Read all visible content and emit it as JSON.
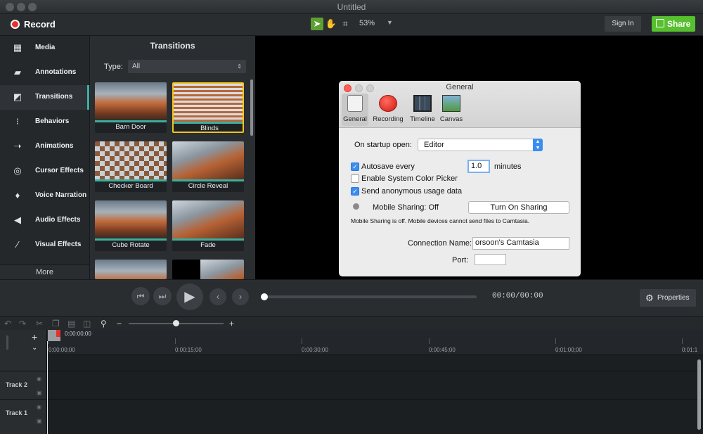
{
  "window": {
    "title": "Untitled"
  },
  "toolbar": {
    "record_label": "Record",
    "zoom": "53%",
    "signin_label": "Sign In",
    "share_label": "Share"
  },
  "sidebar": {
    "items": [
      {
        "label": "Media",
        "icon": "film-icon"
      },
      {
        "label": "Annotations",
        "icon": "annotation-icon"
      },
      {
        "label": "Transitions",
        "icon": "transition-icon"
      },
      {
        "label": "Behaviors",
        "icon": "behavior-icon"
      },
      {
        "label": "Animations",
        "icon": "animation-icon"
      },
      {
        "label": "Cursor Effects",
        "icon": "cursor-icon"
      },
      {
        "label": "Voice Narration",
        "icon": "microphone-icon"
      },
      {
        "label": "Audio Effects",
        "icon": "speaker-icon"
      },
      {
        "label": "Visual Effects",
        "icon": "wand-icon"
      }
    ],
    "active": "Transitions",
    "more_label": "More"
  },
  "panel": {
    "title": "Transitions",
    "type_label": "Type:",
    "type_value": "All",
    "thumbnails": [
      "Barn Door",
      "Blinds",
      "Checker Board",
      "Circle Reveal",
      "Cube Rotate",
      "Fade"
    ],
    "selected": "Blinds"
  },
  "player": {
    "timecode": "00:00/00:00",
    "properties_label": "Properties"
  },
  "timeline": {
    "playhead_time": "0:00:00;00",
    "ruler": [
      "0:00:00;00",
      "0:00:15;00",
      "0:00:30;00",
      "0:00:45;00",
      "0:01:00;00",
      "0:01:1"
    ],
    "tracks": [
      "Track 2",
      "Track 1"
    ]
  },
  "dialog": {
    "title": "General",
    "tabs": [
      "General",
      "Recording",
      "Timeline",
      "Canvas"
    ],
    "startup_label": "On startup open:",
    "startup_value": "Editor",
    "autosave_label": "Autosave every",
    "autosave_value": "1.0",
    "autosave_unit": "minutes",
    "color_picker_label": "Enable System Color Picker",
    "usage_label": "Send anonymous usage data",
    "mobile_label": "Mobile Sharing: Off",
    "mobile_button": "Turn On Sharing",
    "mobile_note": "Mobile Sharing is off. Mobile devices cannot send files to Camtasia.",
    "connection_label": "Connection Name:",
    "connection_value": "orsoon's Camtasia",
    "port_label": "Port:",
    "port_value": ""
  },
  "colors": {
    "accent": "#3cae9e",
    "record": "#e8302b",
    "share": "#56c02e",
    "selected_border": "#f0c419"
  }
}
